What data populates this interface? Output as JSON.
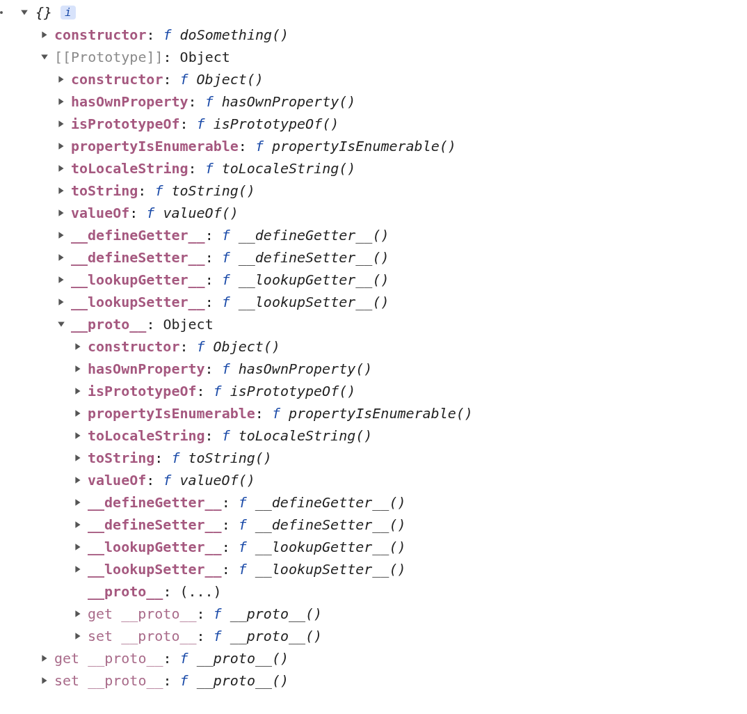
{
  "root": {
    "label": "{}",
    "badge": "i",
    "expanded": true,
    "children": [
      {
        "key": "constructor",
        "kind": "own",
        "expanded": false,
        "separator": ":",
        "prefix": "f",
        "value": "doSomething()"
      },
      {
        "key": "[[Prototype]]",
        "kind": "internal",
        "expanded": true,
        "separator": ":",
        "value": "Object",
        "children": [
          {
            "key": "constructor",
            "kind": "own",
            "expanded": false,
            "separator": ":",
            "prefix": "f",
            "value": "Object()"
          },
          {
            "key": "hasOwnProperty",
            "kind": "own",
            "expanded": false,
            "separator": ":",
            "prefix": "f",
            "value": "hasOwnProperty()"
          },
          {
            "key": "isPrototypeOf",
            "kind": "own",
            "expanded": false,
            "separator": ":",
            "prefix": "f",
            "value": "isPrototypeOf()"
          },
          {
            "key": "propertyIsEnumerable",
            "kind": "own",
            "expanded": false,
            "separator": ":",
            "prefix": "f",
            "value": "propertyIsEnumerable()"
          },
          {
            "key": "toLocaleString",
            "kind": "own",
            "expanded": false,
            "separator": ":",
            "prefix": "f",
            "value": "toLocaleString()"
          },
          {
            "key": "toString",
            "kind": "own",
            "expanded": false,
            "separator": ":",
            "prefix": "f",
            "value": "toString()"
          },
          {
            "key": "valueOf",
            "kind": "own",
            "expanded": false,
            "separator": ":",
            "prefix": "f",
            "value": "valueOf()"
          },
          {
            "key": "__defineGetter__",
            "kind": "own",
            "expanded": false,
            "separator": ":",
            "prefix": "f",
            "value": "__defineGetter__()"
          },
          {
            "key": "__defineSetter__",
            "kind": "own",
            "expanded": false,
            "separator": ":",
            "prefix": "f",
            "value": "__defineSetter__()"
          },
          {
            "key": "__lookupGetter__",
            "kind": "own",
            "expanded": false,
            "separator": ":",
            "prefix": "f",
            "value": "__lookupGetter__()"
          },
          {
            "key": "__lookupSetter__",
            "kind": "own",
            "expanded": false,
            "separator": ":",
            "prefix": "f",
            "value": "__lookupSetter__()"
          },
          {
            "key": "__proto__",
            "kind": "own",
            "expanded": true,
            "separator": ":",
            "value": "Object",
            "children": [
              {
                "key": "constructor",
                "kind": "own",
                "expanded": false,
                "separator": ":",
                "prefix": "f",
                "value": "Object()"
              },
              {
                "key": "hasOwnProperty",
                "kind": "own",
                "expanded": false,
                "separator": ":",
                "prefix": "f",
                "value": "hasOwnProperty()"
              },
              {
                "key": "isPrototypeOf",
                "kind": "own",
                "expanded": false,
                "separator": ":",
                "prefix": "f",
                "value": "isPrototypeOf()"
              },
              {
                "key": "propertyIsEnumerable",
                "kind": "own",
                "expanded": false,
                "separator": ":",
                "prefix": "f",
                "value": "propertyIsEnumerable()"
              },
              {
                "key": "toLocaleString",
                "kind": "own",
                "expanded": false,
                "separator": ":",
                "prefix": "f",
                "value": "toLocaleString()"
              },
              {
                "key": "toString",
                "kind": "own",
                "expanded": false,
                "separator": ":",
                "prefix": "f",
                "value": "toString()"
              },
              {
                "key": "valueOf",
                "kind": "own",
                "expanded": false,
                "separator": ":",
                "prefix": "f",
                "value": "valueOf()"
              },
              {
                "key": "__defineGetter__",
                "kind": "own",
                "expanded": false,
                "separator": ":",
                "prefix": "f",
                "value": "__defineGetter__()"
              },
              {
                "key": "__defineSetter__",
                "kind": "own",
                "expanded": false,
                "separator": ":",
                "prefix": "f",
                "value": "__defineSetter__()"
              },
              {
                "key": "__lookupGetter__",
                "kind": "own",
                "expanded": false,
                "separator": ":",
                "prefix": "f",
                "value": "__lookupGetter__()"
              },
              {
                "key": "__lookupSetter__",
                "kind": "own",
                "expanded": false,
                "separator": ":",
                "prefix": "f",
                "value": "__lookupSetter__()"
              },
              {
                "key": "__proto__",
                "kind": "own",
                "separator": ":",
                "value": "(...)"
              },
              {
                "key": "get __proto__",
                "kind": "accessor",
                "expanded": false,
                "separator": ":",
                "prefix": "f",
                "value": "__proto__()"
              },
              {
                "key": "set __proto__",
                "kind": "accessor",
                "expanded": false,
                "separator": ":",
                "prefix": "f",
                "value": "__proto__()"
              }
            ]
          }
        ]
      },
      {
        "key": "get __proto__",
        "kind": "accessor",
        "expanded": false,
        "separator": ":",
        "prefix": "f",
        "value": "__proto__()"
      },
      {
        "key": "set __proto__",
        "kind": "accessor",
        "expanded": false,
        "separator": ":",
        "prefix": "f",
        "value": "__proto__()"
      }
    ]
  }
}
